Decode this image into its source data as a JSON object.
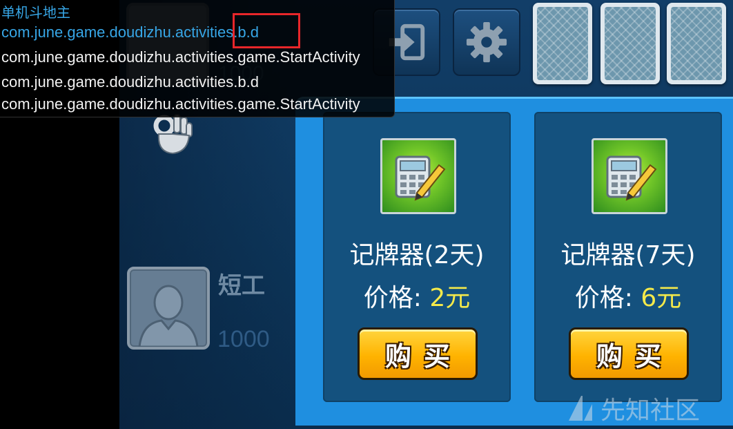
{
  "overlay": {
    "app_title": "单机斗地主",
    "activity_lines": [
      "com.june.game.doudizhu.activities.b.d",
      "com.june.game.doudizhu.activities.game.StartActivity",
      "com.june.game.doudizhu.activities.b.d",
      "com.june.game.doudizhu.activities.game.StartActivity"
    ],
    "colors": {
      "active": "#37a6e6",
      "highlight": "#e8262a"
    }
  },
  "toolbar": {
    "exit_icon": "exit-icon",
    "settings_icon": "gear-icon"
  },
  "players": {
    "top_score": "1000",
    "opponent": {
      "name": "短工",
      "score": "1000"
    }
  },
  "shop": {
    "items": [
      {
        "name": "记牌器(2天)",
        "price_label": "价格:",
        "price_value": "2元",
        "buy_label": "购买"
      },
      {
        "name": "记牌器(7天)",
        "price_label": "价格:",
        "price_value": "6元",
        "buy_label": "购买"
      }
    ],
    "colors": {
      "panel": "#1f8fe0",
      "card": "#14517e",
      "price": "#f4e94a",
      "button": "#ffb300"
    }
  },
  "watermark": {
    "text": "先知社区"
  }
}
